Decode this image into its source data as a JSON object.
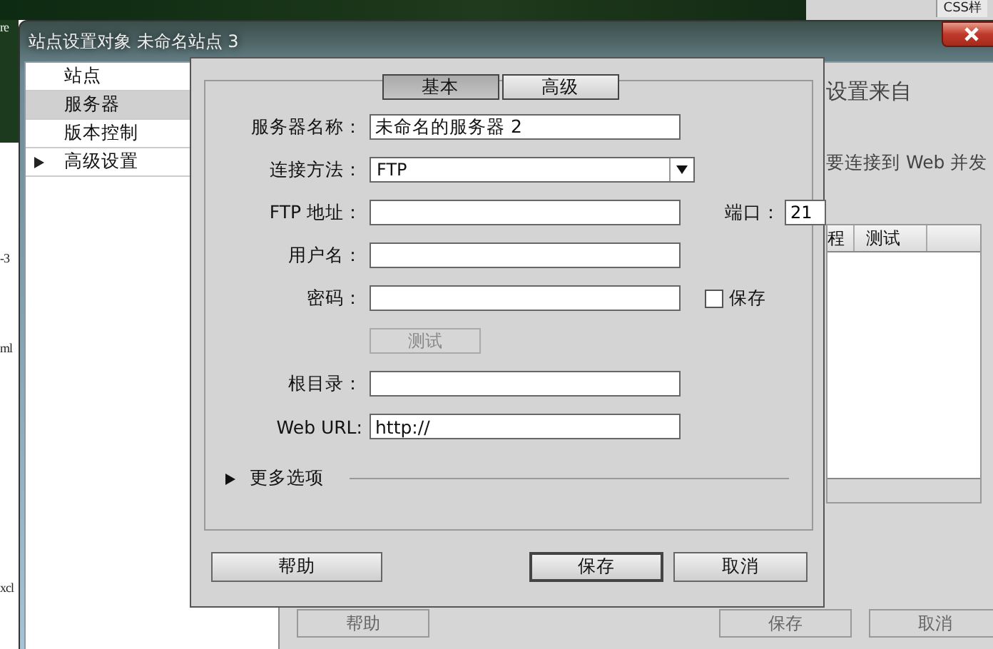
{
  "background_app": {
    "fragments": [
      "re",
      "-3",
      "ml",
      "xcl"
    ],
    "tab": "CSS样"
  },
  "window": {
    "title": "站点设置对象 未命名站点 3",
    "sidebar": {
      "items": [
        {
          "label": "站点",
          "selected": false,
          "has_children": false
        },
        {
          "label": "服务器",
          "selected": true,
          "has_children": false
        },
        {
          "label": "版本控制",
          "selected": false,
          "has_children": false
        },
        {
          "label": "高级设置",
          "selected": false,
          "has_children": true
        }
      ]
    },
    "content_texts": [
      "设置来自",
      "要连接到 Web 并发"
    ],
    "table": {
      "columns": [
        "程",
        "测试"
      ]
    },
    "buttons": [
      {
        "label": "帮助",
        "default": false
      },
      {
        "label": "保存",
        "default": false
      },
      {
        "label": "取消",
        "default": false
      }
    ]
  },
  "dialog": {
    "tabs": [
      {
        "label": "基本",
        "selected": true
      },
      {
        "label": "高级",
        "selected": false
      }
    ],
    "fields": [
      {
        "kind": "text",
        "label": "服务器名称：",
        "value": "未命名的服务器 2"
      },
      {
        "kind": "select",
        "label": "连接方法：",
        "value": "FTP"
      },
      {
        "kind": "text",
        "label": "FTP 地址：",
        "extra": {
          "kind": "port",
          "label": "端口：",
          "value": "21"
        }
      },
      {
        "kind": "text",
        "label": "用户名："
      },
      {
        "kind": "password",
        "label": "密码：",
        "extra": {
          "kind": "checkbox",
          "label": "保存",
          "checked": false
        }
      },
      {
        "kind": "button",
        "label": "测试",
        "disabled": true
      },
      {
        "kind": "text",
        "label": "根目录："
      },
      {
        "kind": "text",
        "label": "Web URL:",
        "value": "http://"
      }
    ],
    "more_options": {
      "label": "更多选项",
      "expanded": false
    },
    "buttons": [
      {
        "label": "帮助",
        "default": false
      },
      {
        "label": "保存",
        "default": true
      },
      {
        "label": "取消",
        "default": false
      }
    ]
  }
}
